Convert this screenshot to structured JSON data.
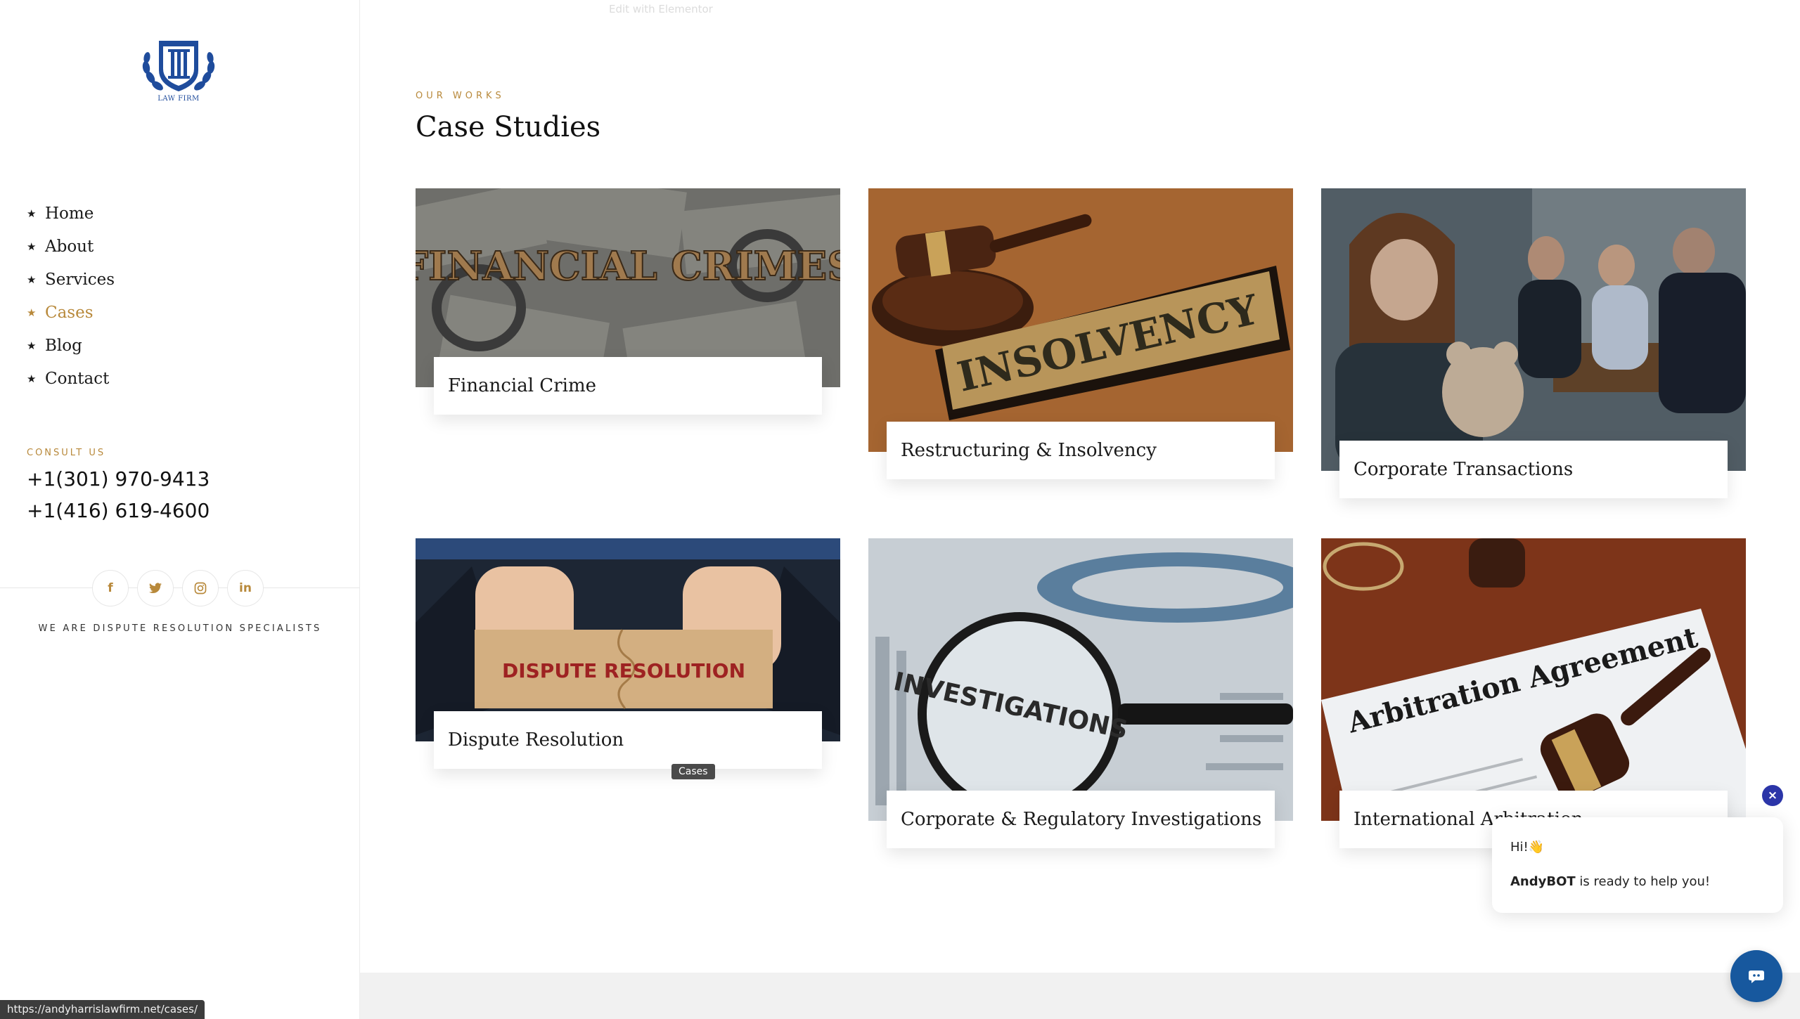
{
  "sidebar": {
    "logo_text": "LAW FIRM",
    "nav": [
      {
        "label": "Home",
        "active": false
      },
      {
        "label": "About",
        "active": false
      },
      {
        "label": "Services",
        "active": false
      },
      {
        "label": "Cases",
        "active": true
      },
      {
        "label": "Blog",
        "active": false
      },
      {
        "label": "Contact",
        "active": false
      }
    ],
    "consult_label": "CONSULT US",
    "phones": [
      "+1(301) 970-9413",
      "+1(416) 619-4600"
    ],
    "socials": [
      {
        "icon": "facebook-icon",
        "glyph": "f"
      },
      {
        "icon": "twitter-icon",
        "glyph": "t"
      },
      {
        "icon": "instagram-icon",
        "glyph": "◎"
      },
      {
        "icon": "linkedin-icon",
        "glyph": "in"
      }
    ],
    "tagline": "WE ARE DISPUTE RESOLUTION SPECIALISTS"
  },
  "main": {
    "edit_link": "Edit with Elementor",
    "eyebrow": "OUR WORKS",
    "title": "Case Studies",
    "cards": [
      {
        "caption": "Financial Crime",
        "image_text": "FINANCIAL CRIMES"
      },
      {
        "caption": "Restructuring & Insolvency",
        "image_text": "INSOLVENCY"
      },
      {
        "caption": "Corporate Transactions",
        "image_text": ""
      },
      {
        "caption": "Dispute Resolution",
        "image_text": "DISPUTE RESOLUTION"
      },
      {
        "caption": "Corporate & Regulatory Investigations",
        "image_text": "INVESTIGATIONS"
      },
      {
        "caption": "International Arbitration",
        "image_text": "Arbitration Agreement"
      }
    ],
    "tooltip": "Cases"
  },
  "status_bar": {
    "url": "https://andyharrislawfirm.net/cases/"
  },
  "chatbot": {
    "greeting": "Hi!👋",
    "bot_name": "AndyBOT",
    "message": " is ready to help you!",
    "close_glyph": "×"
  },
  "colors": {
    "accent": "#b8893b",
    "chat_blue": "#17589e",
    "close_blue": "#2b35a8"
  }
}
